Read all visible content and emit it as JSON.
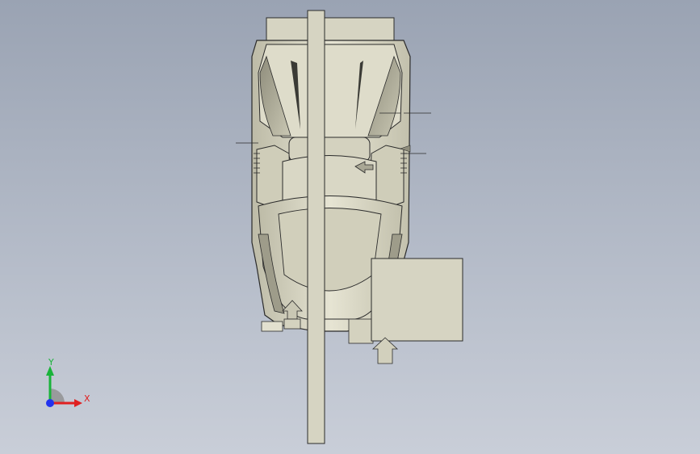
{
  "viewport": {
    "background_top": "#9aa3b3",
    "background_bottom": "#c9ced8",
    "model_fill": "#d8d6c4",
    "model_shade": "#b9b7a4",
    "model_stroke": "#2b2b2b"
  },
  "triad": {
    "x_label": "X",
    "y_label": "Y",
    "x_color": "#e02020",
    "y_color": "#19b33a",
    "z_color": "#2233ee"
  }
}
